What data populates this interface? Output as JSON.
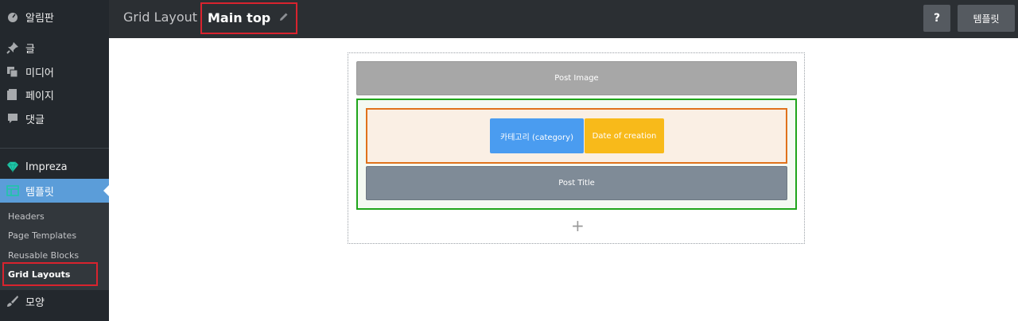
{
  "sidebar": {
    "items": [
      {
        "label": "알림판",
        "icon": "dashboard-icon"
      },
      {
        "label": "글",
        "icon": "pushpin-icon"
      },
      {
        "label": "미디어",
        "icon": "media-icon"
      },
      {
        "label": "페이지",
        "icon": "page-icon"
      },
      {
        "label": "댓글",
        "icon": "comment-icon"
      }
    ],
    "impreza": {
      "label": "Impreza",
      "icon": "diamond-icon"
    },
    "templates": {
      "label": "템플릿",
      "icon": "template-icon"
    },
    "submenu": [
      "Headers",
      "Page Templates",
      "Reusable Blocks",
      "Grid Layouts"
    ],
    "appearance": {
      "label": "모양",
      "icon": "paintbrush-icon"
    }
  },
  "topbar": {
    "breadcrumb": "Grid Layout",
    "title": "Main top",
    "help_label": "?",
    "templates_label": "템플릿"
  },
  "canvas": {
    "post_image": "Post Image",
    "category": "카테고리 (category)",
    "date": "Date of creation",
    "post_title": "Post Title",
    "add": "+"
  },
  "colors": {
    "highlight": "#d9232e",
    "active_menu": "#5b9dd9",
    "green_outline": "#1fa51b",
    "orange_outline": "#e0721c",
    "category_blue": "#4a9cf0",
    "date_yellow": "#f8ba1a"
  }
}
